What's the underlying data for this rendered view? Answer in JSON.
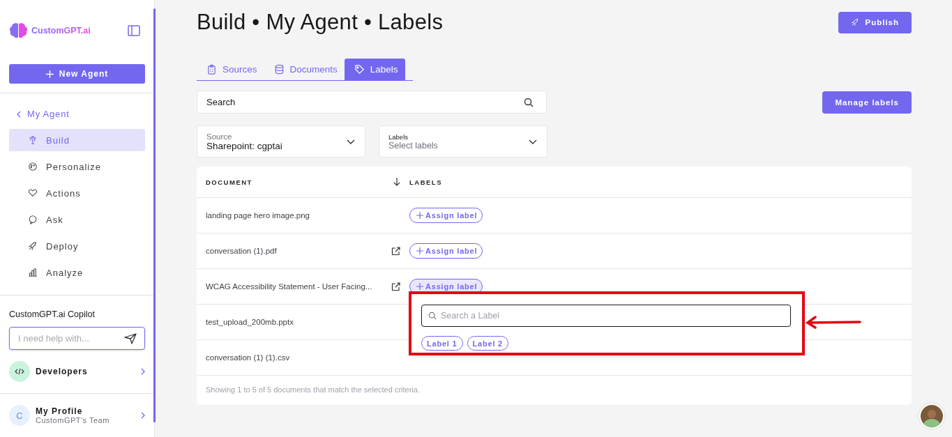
{
  "sidebar": {
    "brand": "CustomGPT.ai",
    "new_agent": "New Agent",
    "back": "My Agent",
    "items": [
      {
        "label": "Build",
        "selected": true
      },
      {
        "label": "Personalize",
        "selected": false
      },
      {
        "label": "Actions",
        "selected": false
      },
      {
        "label": "Ask",
        "selected": false
      },
      {
        "label": "Deploy",
        "selected": false
      },
      {
        "label": "Analyze",
        "selected": false
      }
    ],
    "copilot": {
      "title": "CustomGPT.ai Copilot",
      "placeholder": "I need help with..."
    },
    "developers": "Developers",
    "profile": {
      "initial": "C",
      "name": "My Profile",
      "team": "CustomGPT's Team"
    }
  },
  "header": {
    "title": "Build • My Agent • Labels",
    "publish": "Publish"
  },
  "tabs": [
    {
      "label": "Sources",
      "selected": false
    },
    {
      "label": "Documents",
      "selected": false
    },
    {
      "label": "Labels",
      "selected": true
    }
  ],
  "search": {
    "placeholder": "Search"
  },
  "manage_labels": "Manage labels",
  "filters": [
    {
      "label": "Source",
      "value": "Sharepoint: cgptai",
      "kind": "value"
    },
    {
      "label": "Labels",
      "placeholder": "Select labels",
      "kind": "placeholder"
    }
  ],
  "table": {
    "columns": [
      "DOCUMENT",
      "LABELS"
    ],
    "rows": [
      {
        "document": "landing page hero image.png",
        "external_link": false,
        "assign_label": "Assign label",
        "active": false
      },
      {
        "document": "conversation (1).pdf",
        "external_link": true,
        "assign_label": "Assign label",
        "active": false
      },
      {
        "document": "WCAG Accessibility Statement - User Facing...",
        "external_link": true,
        "assign_label": "Assign label",
        "active": true
      },
      {
        "document": "test_upload_200mb.pptx",
        "external_link": false
      },
      {
        "document": "conversation (1) (1).csv",
        "external_link": false
      }
    ],
    "footer": "Showing 1 to 5 of 5 documents that match the selected criteria."
  },
  "label_popup": {
    "placeholder": "Search a Label",
    "labels": [
      "Label 1",
      "Label 2"
    ]
  }
}
